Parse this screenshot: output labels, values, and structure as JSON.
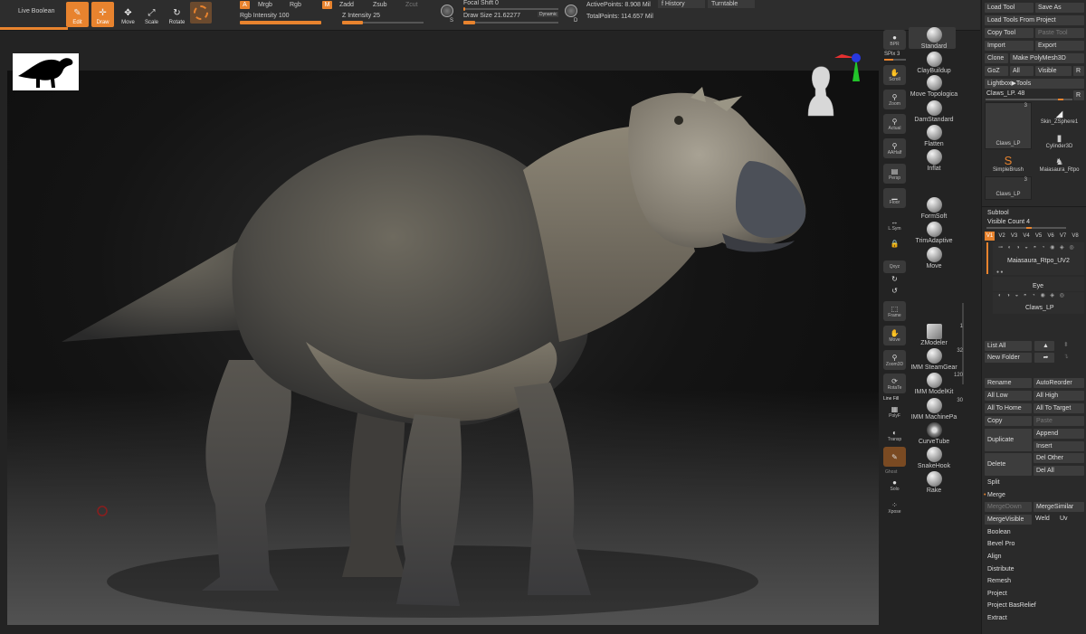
{
  "toolbar": {
    "live_boolean": "Live Boolean",
    "edit": "Edit",
    "draw": "Draw",
    "move": "Move",
    "scale": "Scale",
    "rotate": "Rotate",
    "a_badge": "A",
    "mrgb": "Mrgb",
    "rgb": "Rgb",
    "m_badge": "M",
    "zadd": "Zadd",
    "zsub": "Zsub",
    "zcut": "Zcut",
    "rgb_intensity_label": "Rgb Intensity",
    "rgb_intensity_value": "100",
    "z_intensity_label": "Z Intensity",
    "z_intensity_value": "25",
    "s_badge": "S",
    "d_badge": "D",
    "focal_shift": "Focal Shift 0",
    "draw_size": "Draw Size 21.62277",
    "dynamic": "Dynamic",
    "active_points": "ActivePoints: 8.908 Mil",
    "total_points": "TotalPoints: 114.657 Mil",
    "history": "History",
    "turntable": "Turntable",
    "rgb_intensity_level": 1.0,
    "z_intensity_level": 0.25,
    "draw_size_level": 0.12
  },
  "shelf": {
    "bpr": "BPR",
    "spix": "SPix 3",
    "scroll": "Scroll",
    "zoom": "Zoom",
    "actual": "Actual",
    "aahalf": "AAHalf",
    "persp": "Persp",
    "floor": "Floor",
    "lsym": "L.Sym",
    "xyz": "Qxyz",
    "frame": "Frame",
    "move": "Move",
    "zoom3d": "Zoom3D",
    "rotate": "RotaTe",
    "line_fill": "Line Fill",
    "polyf": "PolyF",
    "transp": "Transp",
    "ghost": "Ghost",
    "solo": "Solo",
    "xpose": "Xpose"
  },
  "brushes": {
    "standard": "Standard",
    "claybuildup": "ClayBuildup",
    "move_topological": "Move Topologica",
    "damstandard": "DamStandard",
    "flatten": "Flatten",
    "inflat": "Inflat",
    "formsoft": "FormSoft",
    "trimadaptive": "TrimAdaptive",
    "move": "Move",
    "zmodeler": "ZModeler",
    "zmodeler_count": "1",
    "imm_steamgear": "IMM SteamGear",
    "imm_steamgear_count": "32",
    "imm_modelkit": "IMM ModelKit",
    "imm_modelkit_count": "120",
    "imm_machineparts": "IMM MachinePa",
    "imm_machineparts_count": "30",
    "curvetube": "CurveTube",
    "snakehook": "SnakeHook",
    "rake": "Rake"
  },
  "tool_panel": {
    "load_tool": "Load Tool",
    "save_as": "Save As",
    "load_tools_from_project": "Load Tools From Project",
    "copy_tool": "Copy Tool",
    "paste_tool": "Paste Tool",
    "import": "Import",
    "export": "Export",
    "clone": "Clone",
    "make_polymesh3d": "Make PolyMesh3D",
    "goz": "GoZ",
    "all": "All",
    "visible": "Visible",
    "r": "R",
    "lightbox_tools": "Lightbox▶Tools",
    "current_tool": "Claws_LP. 48",
    "r2": "R",
    "thumb1_count": "3",
    "thumb1_label": "Claws_LP",
    "thumb2_label": "Skin_ZSphere1",
    "thumb3_label": "Cylinder3D",
    "thumb4_label": "SimpleBrush",
    "thumb5_label": "Maiasaura_Rtpo",
    "thumb6_count": "3",
    "thumb6_label": "Claws_LP"
  },
  "subtool": {
    "title": "Subtool",
    "visible_count": "Visible Count 4",
    "tabs": [
      "V1",
      "V2",
      "V3",
      "V4",
      "V5",
      "V6",
      "V7",
      "V8"
    ],
    "item1": "Maiasaura_Rtpo_UV2",
    "item2": "Eye",
    "item3": "Claws_LP",
    "list_all": "List All",
    "new_folder": "New Folder",
    "rename": "Rename",
    "autoreorder": "AutoReorder",
    "all_low": "All Low",
    "all_high": "All High",
    "all_to_home": "All To Home",
    "all_to_target": "All To Target",
    "copy": "Copy",
    "paste": "Paste",
    "append": "Append",
    "duplicate": "Duplicate",
    "insert": "Insert",
    "delete": "Delete",
    "del_other": "Del Other",
    "del_all": "Del All",
    "split": "Split",
    "merge": "Merge",
    "merge_down": "MergeDown",
    "merge_similar": "MergeSimilar",
    "merge_visible": "MergeVisible",
    "weld": "Weld",
    "uv": "Uv",
    "boolean": "Boolean",
    "bevel_pro": "Bevel Pro",
    "align": "Align",
    "distribute": "Distribute",
    "remesh": "Remesh",
    "project": "Project",
    "project_basrelief": "Project BasRelief",
    "extract": "Extract"
  },
  "colors": {
    "accent": "#e8832e",
    "panel": "#2a2a2a",
    "button": "#3d3d3d",
    "viewport": "#101010"
  }
}
